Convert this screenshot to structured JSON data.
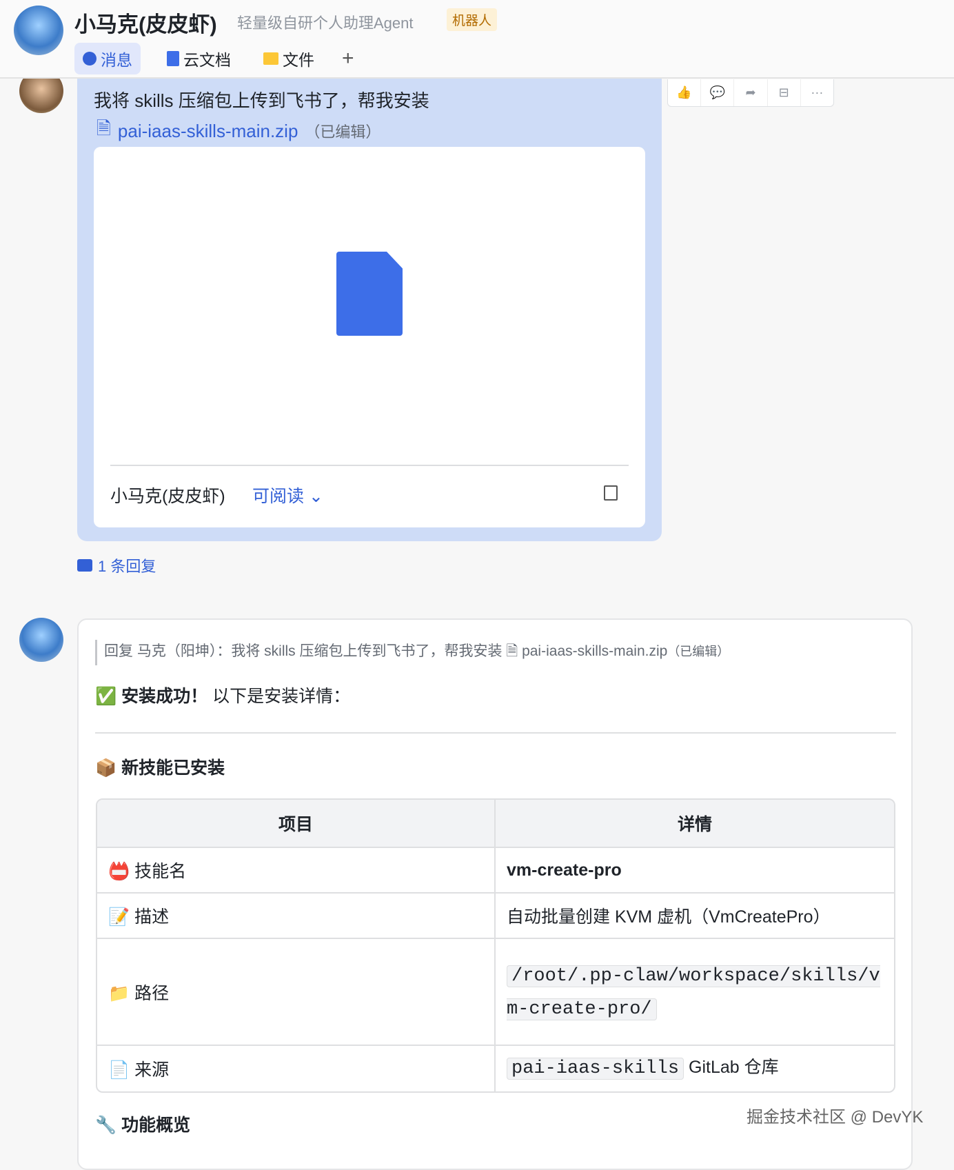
{
  "header": {
    "title": "小马克(皮皮虾)",
    "subtitle": "轻量级自研个人助理Agent",
    "badge": "机器人",
    "tabs": [
      {
        "label": "消息"
      },
      {
        "label": "云文档"
      },
      {
        "label": "文件"
      },
      {
        "label": "+"
      }
    ]
  },
  "message1": {
    "text": "我将 skills 压缩包上传到飞书了，帮我安装",
    "file": "pai-iaas-skills-main.zip",
    "edited": "（已编辑）",
    "owner": "小马克(皮皮虾)",
    "permission": "可阅读 ⌄",
    "replies": "1 条回复"
  },
  "toolbar": [
    "👍",
    "💬",
    "➦",
    "⊟",
    "···"
  ],
  "message2": {
    "quote": "回复 马克（阳坤）：我将 skills 压缩包上传到飞书了，帮我安装",
    "quote_file": "pai-iaas-skills-main.zip",
    "quote_edited": "（已编辑）",
    "success_bold": "安装成功！",
    "success_rest": "以下是安装详情：",
    "heading": "新技能已安装",
    "heading2": "功能概览",
    "table": {
      "headers": [
        "项目",
        "详情"
      ],
      "rows": [
        {
          "icon": "📛",
          "key": "技能名",
          "value": "vm-create-pro"
        },
        {
          "icon": "📝",
          "key": "描述",
          "value": "自动批量创建 KVM 虚机（VmCreatePro）"
        },
        {
          "icon": "📁",
          "key": "路径",
          "code": "/root/.pp-claw/workspace/skills/vm-create-pro/"
        },
        {
          "icon": "📄",
          "key": "来源",
          "code": "pai-iaas-skills",
          "value": " GitLab 仓库"
        }
      ]
    }
  },
  "watermark": "掘金技术社区 @ DevYK"
}
